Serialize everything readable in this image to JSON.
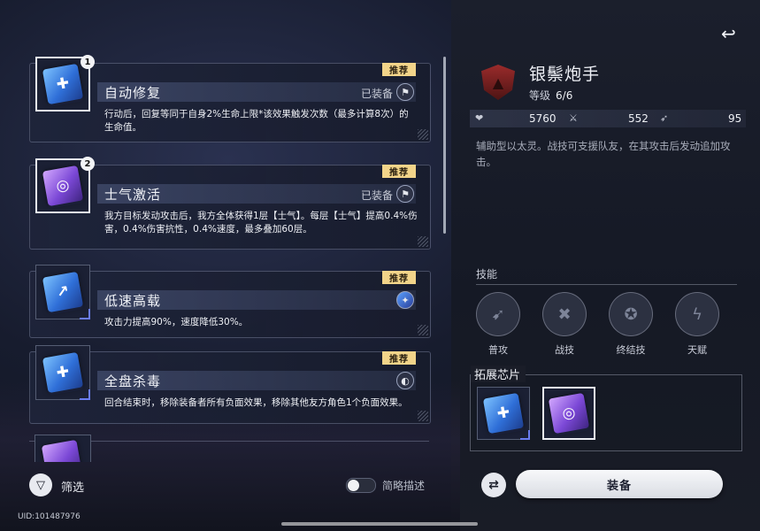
{
  "chips": [
    {
      "name": "自动修复",
      "badge": "1",
      "recommend": "推荐",
      "status": "已装备",
      "desc": "行动后，回复等同于自身2%生命上限*该效果触发次数（最多计算8次）的生命值。",
      "color": "blue",
      "glyph": "✚"
    },
    {
      "name": "士气激活",
      "badge": "2",
      "recommend": "推荐",
      "status": "已装备",
      "desc": "我方目标发动攻击后，我方全体获得1层【士气】。每层【士气】提高0.4%伤害，0.4%伤害抗性，0.4%速度，最多叠加60层。",
      "color": "purple",
      "glyph": "◎"
    },
    {
      "name": "低速高载",
      "recommend": "推荐",
      "desc": "攻击力提高90%，速度降低30%。",
      "color": "blue",
      "glyph": "↗"
    },
    {
      "name": "全盘杀毒",
      "recommend": "推荐",
      "desc": "回合结束时，移除装备者所有负面效果，移除其他友方角色1个负面效果。",
      "color": "blue",
      "glyph": "✚"
    }
  ],
  "bottom": {
    "filter_label": "筛选",
    "brief_desc_label": "简略描述",
    "uid": "UID:101487976"
  },
  "agent": {
    "name": "银鬃炮手",
    "level_label": "等级",
    "level_value": "6/6",
    "hp": "5760",
    "atk": "552",
    "spd": "95",
    "desc": "辅助型以太灵。战技可支援队友，在其攻击后发动追加攻击。",
    "skills_title": "技能",
    "skills": [
      "普攻",
      "战技",
      "终结技",
      "天赋"
    ],
    "ext_title": "拓展芯片",
    "equip_label": "装备"
  },
  "colors": {
    "recommend_bg": "#f2d489",
    "accent_blue": "#6a7cf0"
  }
}
